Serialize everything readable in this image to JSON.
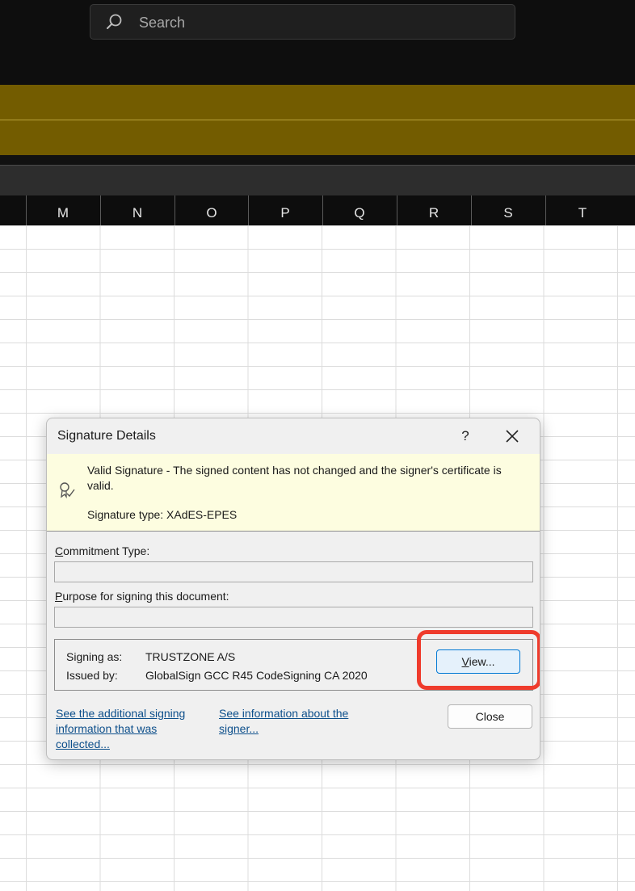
{
  "search": {
    "placeholder": "Search"
  },
  "columns": [
    "M",
    "N",
    "O",
    "P",
    "Q",
    "R",
    "S",
    "T"
  ],
  "dialog": {
    "title": "Signature Details",
    "help_label": "?",
    "valid_text": "Valid Signature - The signed content has not changed and the signer's certificate is valid.",
    "signature_type": "Signature type: XAdES-EPES",
    "commitment_label_accel": "C",
    "commitment_label_rest": "ommitment Type:",
    "commitment_value": "",
    "purpose_label_accel": "P",
    "purpose_label_rest": "urpose for signing this document:",
    "purpose_value": "",
    "signing_as_label": "Signing as:",
    "signing_as_value": "TRUSTZONE A/S",
    "issued_by_label": "Issued by:",
    "issued_by_value": "GlobalSign GCC R45 CodeSigning CA 2020",
    "view_button_accel": "V",
    "view_button_rest": "iew...",
    "link_additional": "See the additional signing information that was collected...",
    "link_signer": "See information about the signer...",
    "close_button": "Close"
  },
  "colors": {
    "message_bar": "#735c00",
    "highlight": "#ef3b2c",
    "info_panel": "#fdfde0",
    "link": "#0d4f8b"
  },
  "icons": [
    "search-icon",
    "close-icon",
    "signature-ribbon-icon"
  ]
}
